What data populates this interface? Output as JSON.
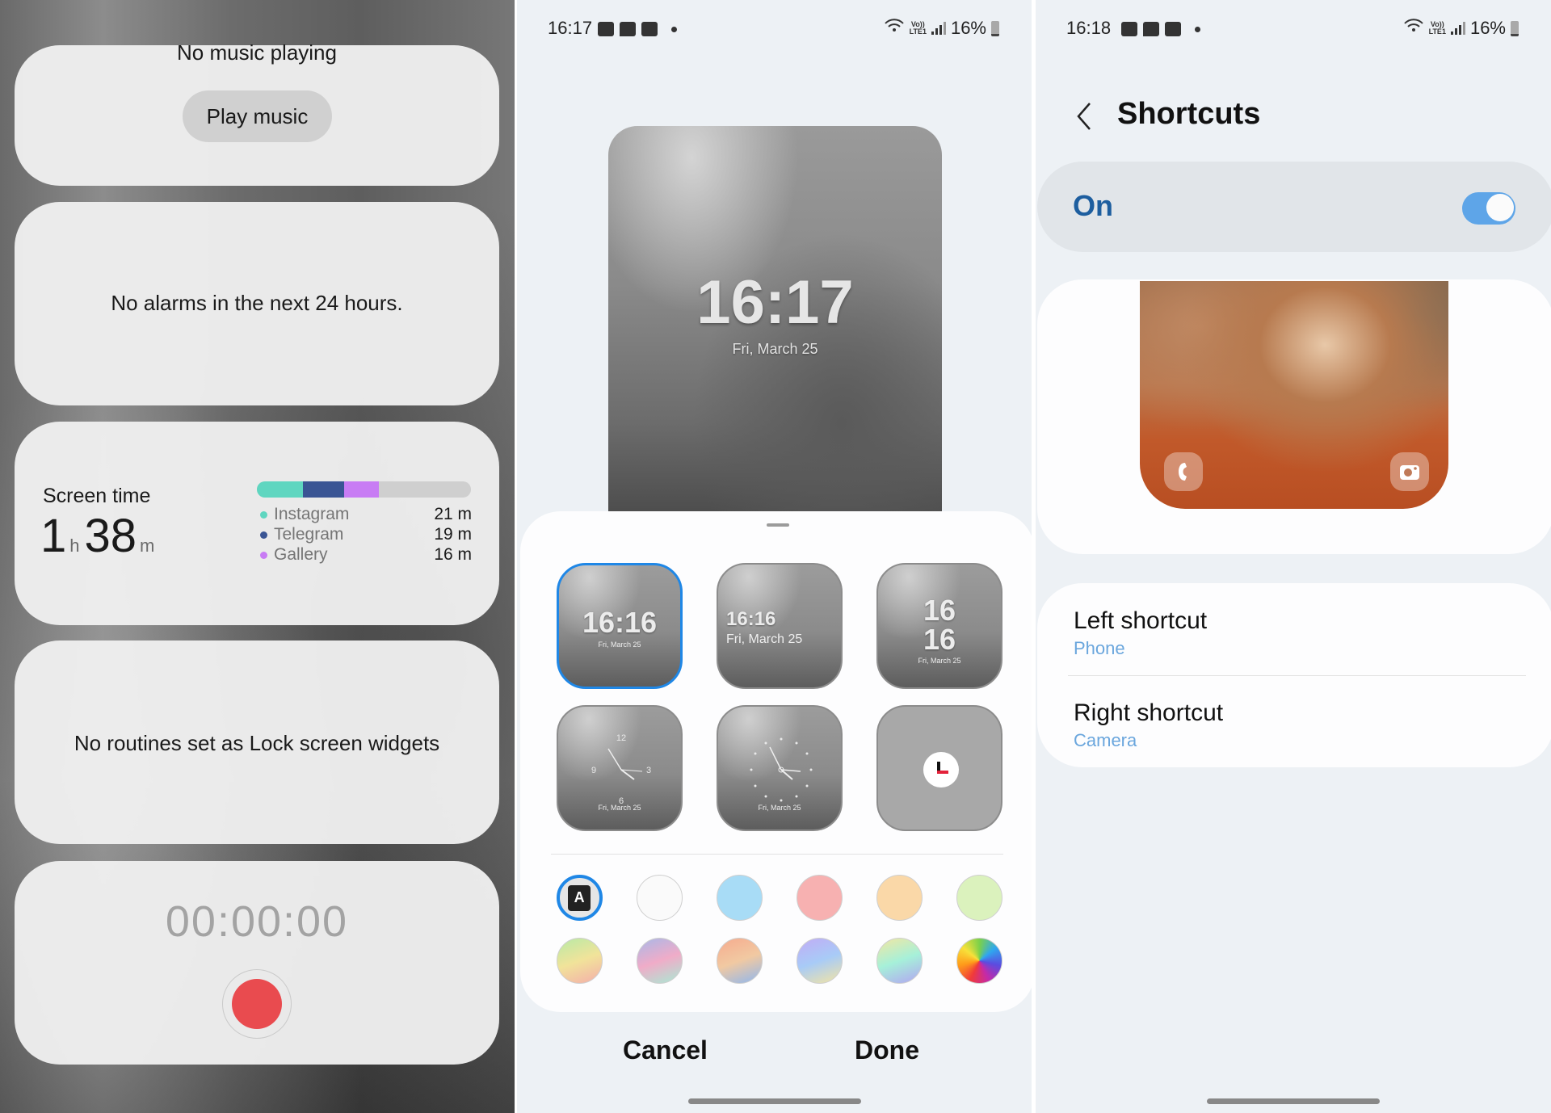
{
  "left_panel": {
    "music_widget": {
      "status": "No music playing",
      "play_button": "Play music"
    },
    "alarm_widget": {
      "message": "No alarms in the next 24 hours."
    },
    "screen_time_widget": {
      "label": "Screen time",
      "total_hours": "1",
      "hours_unit": "h",
      "total_minutes": "38",
      "minutes_unit": "m",
      "apps": [
        {
          "name": "Instagram",
          "time": "21 m",
          "minutes": 21,
          "color": "#5fd6c0"
        },
        {
          "name": "Telegram",
          "time": "19 m",
          "minutes": 19,
          "color": "#3a5594"
        },
        {
          "name": "Gallery",
          "time": "16 m",
          "minutes": 16,
          "color": "#c87cf4"
        }
      ],
      "total_minutes_value": 98,
      "bar_rest_color": "#cfcfcf"
    },
    "routines_widget": {
      "message": "No routines set as Lock screen widgets"
    },
    "recorder_widget": {
      "timer": "00:00:00",
      "record_color": "#e94b4f"
    }
  },
  "middle_panel": {
    "status_bar": {
      "time": "16:17",
      "battery": "16%",
      "network": "LTE1",
      "volte": "Vo))"
    },
    "lock_preview": {
      "time": "16:17",
      "date": "Fri, March 25"
    },
    "clock_styles": [
      {
        "id": "digital-centered",
        "time": "16:16",
        "date": "Fri, March 25",
        "selected": true
      },
      {
        "id": "digital-left",
        "time": "16:16",
        "date": "Fri, March 25",
        "selected": false
      },
      {
        "id": "digital-stacked",
        "hour": "16",
        "minute": "16",
        "date": "Fri, March 25",
        "selected": false
      },
      {
        "id": "analog-numbers",
        "date": "Fri, March 25",
        "selected": false
      },
      {
        "id": "analog-dots",
        "date": "Fri, March 25",
        "selected": false
      },
      {
        "id": "app-icon-clock",
        "selected": false
      }
    ],
    "color_swatches": [
      {
        "name": "auto-contrast",
        "selected": true,
        "label": "A"
      },
      {
        "name": "white",
        "color": "#fafafa"
      },
      {
        "name": "light-blue",
        "color": "#a8dcf6"
      },
      {
        "name": "pink",
        "color": "#f7b1b1"
      },
      {
        "name": "peach",
        "color": "#fad8a8"
      },
      {
        "name": "light-green",
        "color": "#dbf2bd"
      },
      {
        "name": "gradient-green-pink",
        "gradient": [
          "#b8eaa6",
          "#f1e39a",
          "#f4aeaa"
        ]
      },
      {
        "name": "gradient-blue-pink-mint",
        "gradient": [
          "#a9b8e8",
          "#f0acc8",
          "#a9ead4"
        ]
      },
      {
        "name": "gradient-orange-blue",
        "gradient": [
          "#f6ab8e",
          "#f1c9a2",
          "#8fb7ef"
        ]
      },
      {
        "name": "gradient-violet-blue-yellow",
        "gradient": [
          "#c1acf6",
          "#a8cbf7",
          "#f3e4a4"
        ]
      },
      {
        "name": "gradient-yellow-mint-violet",
        "gradient": [
          "#f2e7a2",
          "#a6f0d9",
          "#b2a5f2"
        ]
      },
      {
        "name": "rainbow",
        "rainbow": true
      }
    ],
    "footer": {
      "cancel": "Cancel",
      "done": "Done"
    }
  },
  "right_panel": {
    "status_bar": {
      "time": "16:18",
      "battery": "16%",
      "network": "LTE1",
      "volte": "Vo))"
    },
    "title": "Shortcuts",
    "master_toggle": {
      "label": "On",
      "enabled": true,
      "accent": "#5ea5e8"
    },
    "preview": {
      "left_icon": "phone",
      "right_icon": "camera"
    },
    "items": [
      {
        "title": "Left shortcut",
        "value": "Phone"
      },
      {
        "title": "Right shortcut",
        "value": "Camera"
      }
    ]
  }
}
